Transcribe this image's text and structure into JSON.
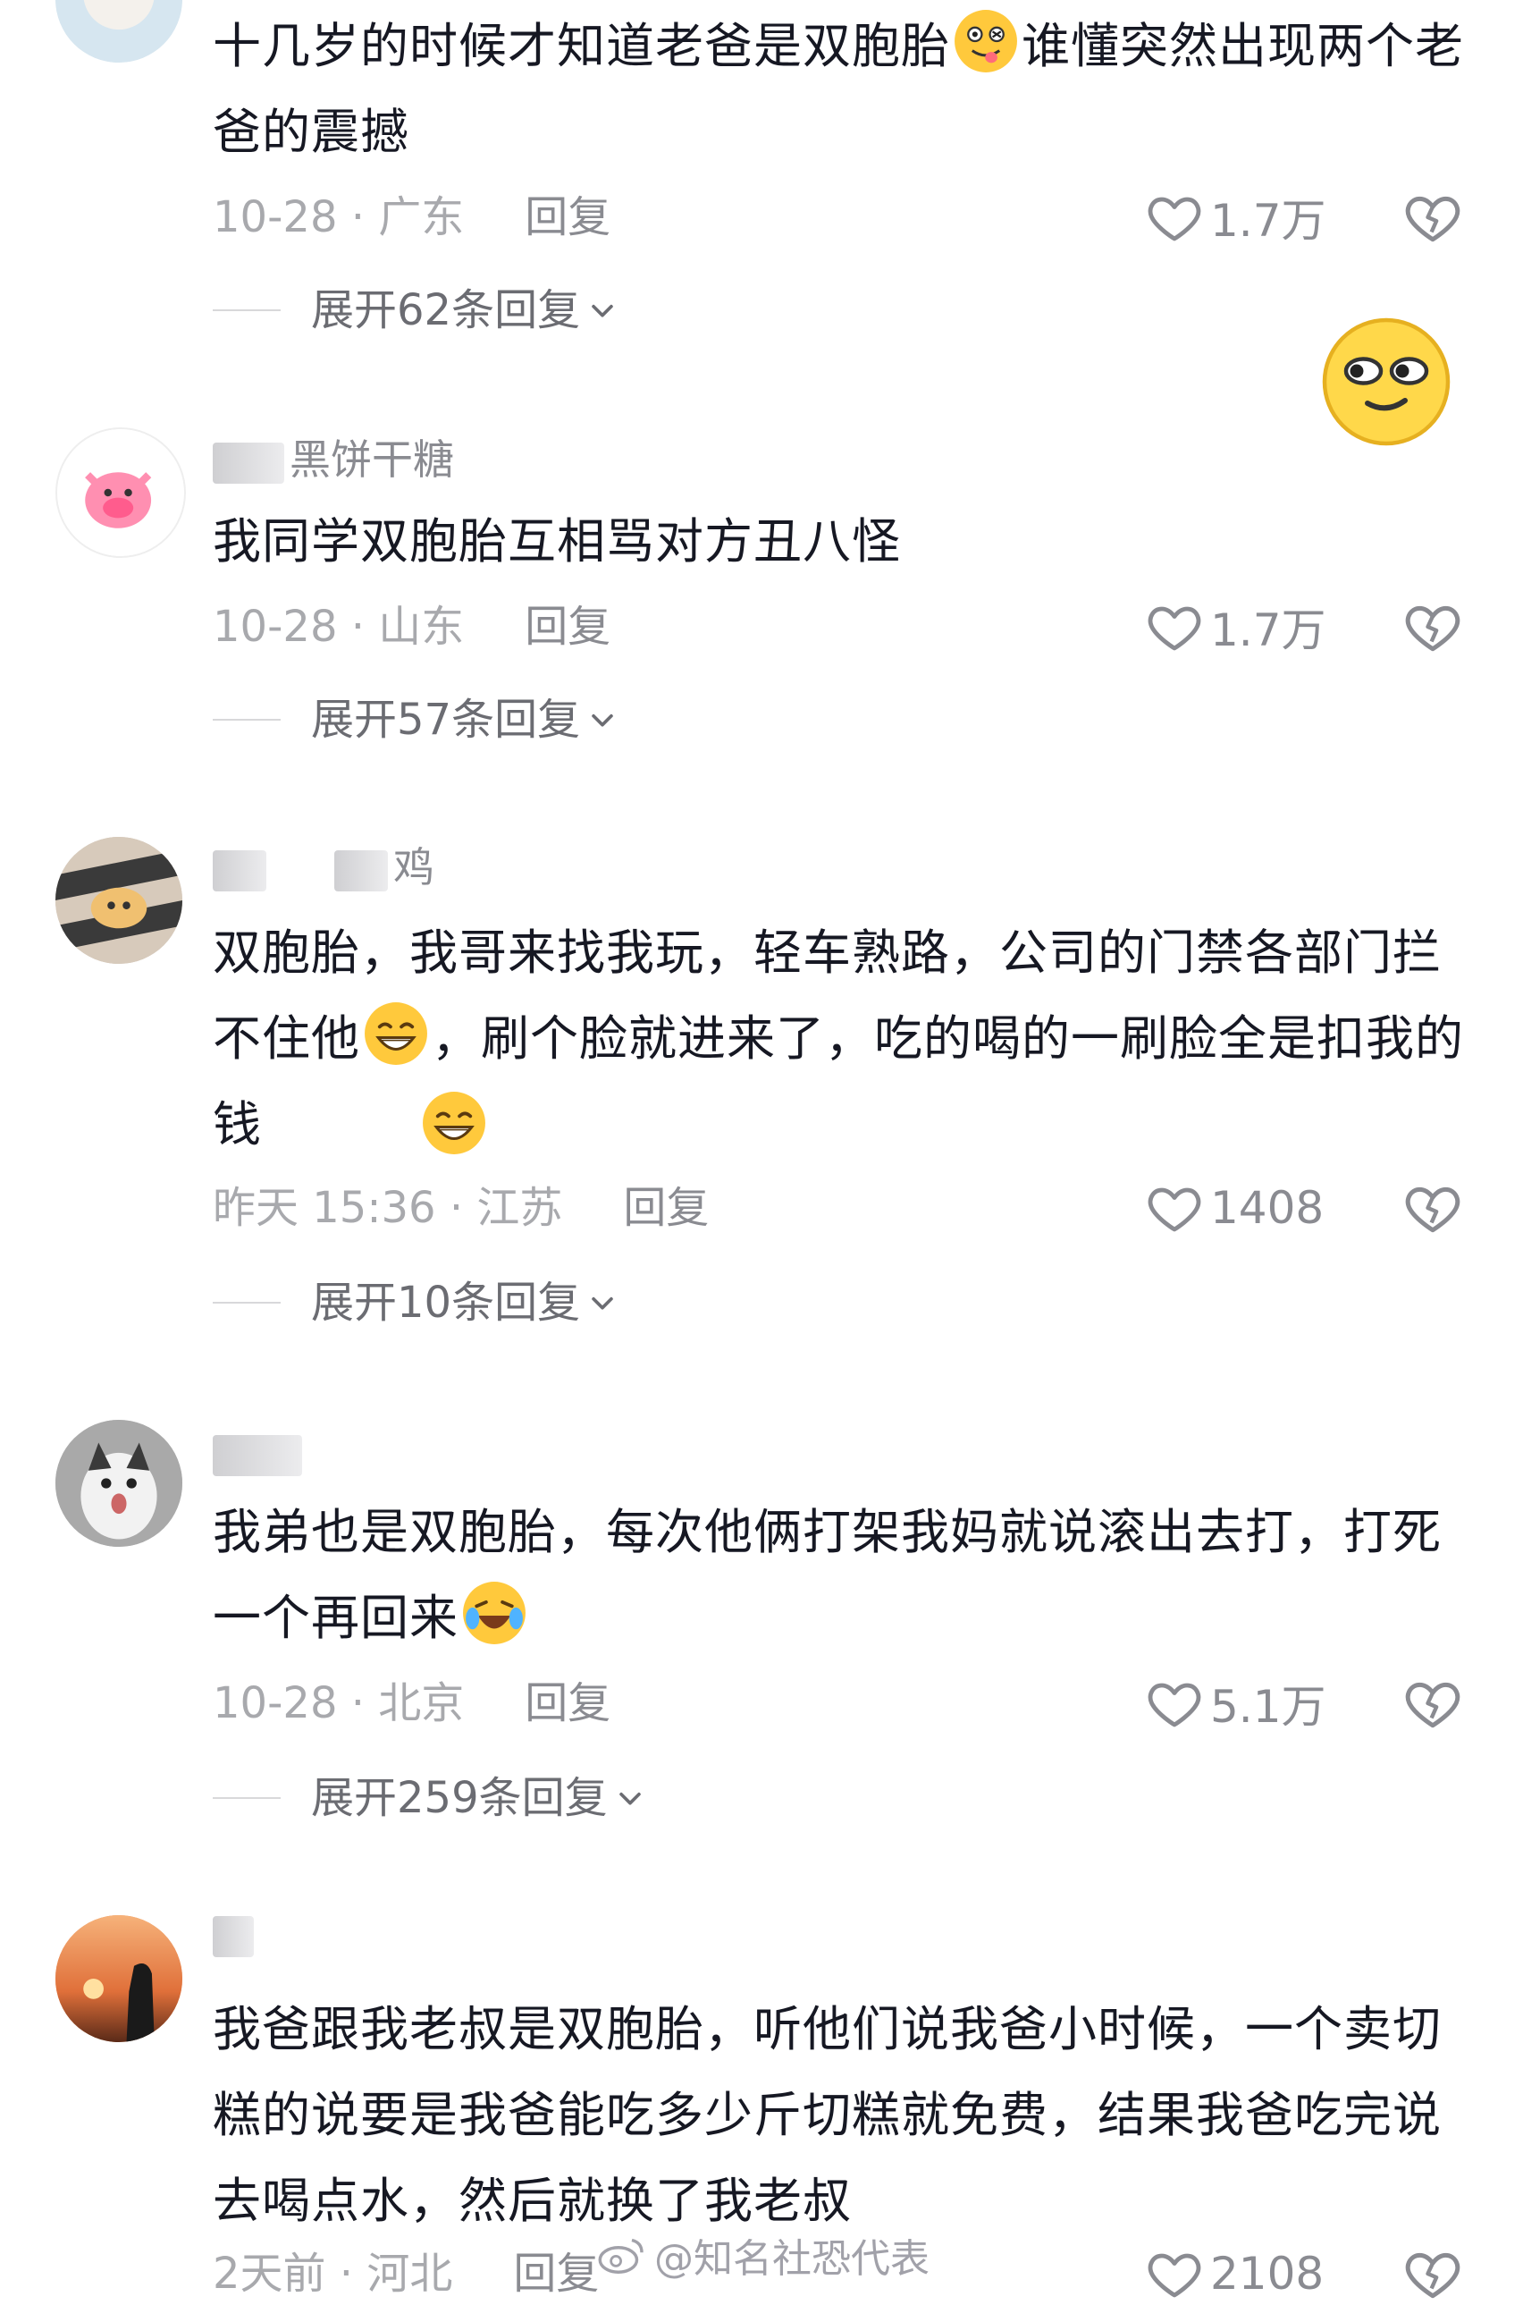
{
  "comments": [
    {
      "username": "",
      "text_parts": [
        "十几岁的时候才知道老爸是双胞胎",
        "谁懂突然出现两个老爸的震撼"
      ],
      "emoji": "tongue-face-emoji",
      "time_location": "10-28 · 广东",
      "reply_label": "回复",
      "likes": "1.7万",
      "expand_label": "展开62条回复"
    },
    {
      "username": "黑饼干糖",
      "text": "我同学双胞胎互相骂对方丑八怪",
      "time_location": "10-28 · 山东",
      "reply_label": "回复",
      "likes": "1.7万",
      "expand_label": "展开57条回复"
    },
    {
      "username": "鸡",
      "text_parts": [
        "双胞胎，我哥来找我玩，轻车熟路，公司的门禁各部门拦不住他",
        "，刷个脸就进来了，吃的喝的一刷脸全是扣我的钱"
      ],
      "emoji": "grin-emoji",
      "time_location": "昨天 15:36 · 江苏",
      "reply_label": "回复",
      "likes": "1408",
      "expand_label": "展开10条回复"
    },
    {
      "username": "",
      "text": "我弟也是双胞胎，每次他俩打架我妈就说滚出去打，打死一个再回来",
      "emoji": "laugh-cry-emoji",
      "time_location": "10-28 · 北京",
      "reply_label": "回复",
      "likes": "5.1万",
      "expand_label": "展开259条回复"
    },
    {
      "username": "",
      "text": "我爸跟我老叔是双胞胎，听他们说我爸小时候，一个卖切糕的说要是我爸能吃多少斤切糕就免费，结果我爸吃完说去喝点水，然后就换了我老叔",
      "time_location": "2天前 · 河北",
      "reply_label": "回复",
      "likes": "2108"
    }
  ],
  "watermark": "@知名社恐代表",
  "icons": {
    "like": "heart-outline-icon",
    "dislike": "broken-heart-icon",
    "expand": "chevron-down-icon"
  },
  "colors": {
    "text": "#161823",
    "meta": "#a8a9ad",
    "reply": "#8a8b91"
  }
}
